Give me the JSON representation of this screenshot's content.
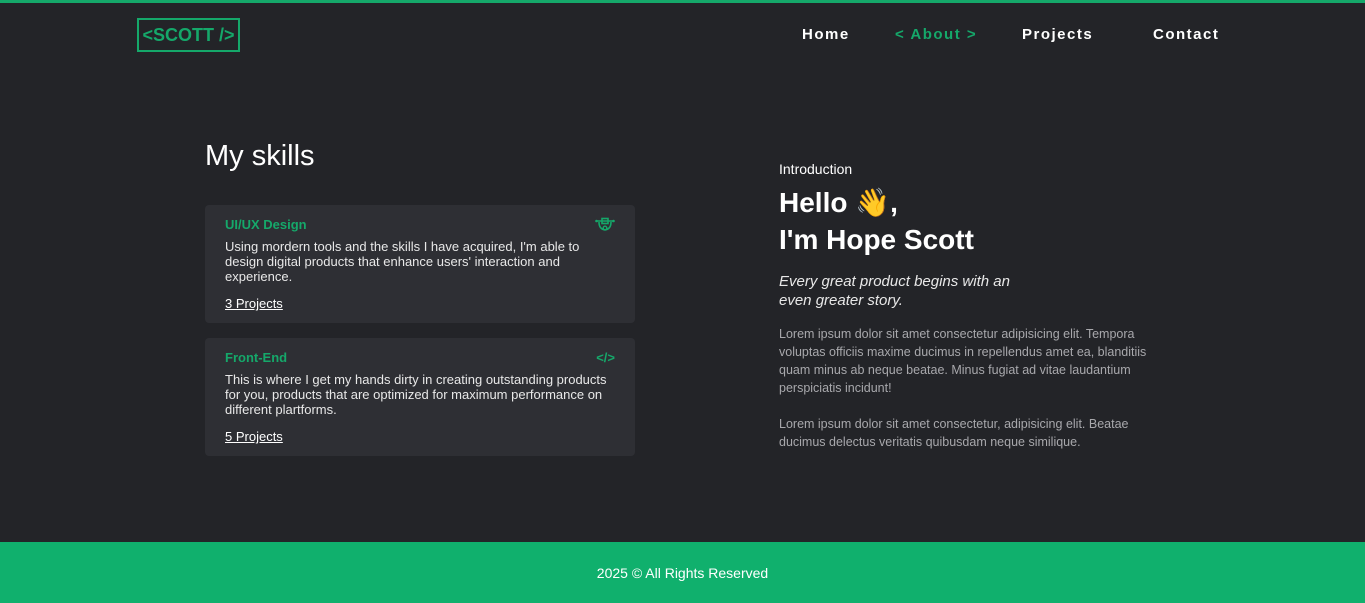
{
  "header": {
    "logo": "<SCOTT />",
    "nav": [
      {
        "label": "Home"
      },
      {
        "label": "< About >"
      },
      {
        "label": "Projects"
      },
      {
        "label": "Contact"
      }
    ]
  },
  "skills": {
    "title": "My skills",
    "items": [
      {
        "title": "UI/UX Design",
        "icon": "design-tool-icon",
        "desc": "Using mordern tools and the skills I have acquired, I'm able to design digital products that enhance users' interaction and experience.",
        "link": "3 Projects"
      },
      {
        "title": "Front-End",
        "icon": "code-icon",
        "icon_glyph": "</>",
        "desc": "This is where I get my hands dirty in creating outstanding products for you, products that are optimized for maximum performance on different plartforms.",
        "link": "5 Projects"
      }
    ]
  },
  "intro": {
    "label": "Introduction",
    "hello": "Hello",
    "wave": "👋",
    "comma": ",",
    "name": "I'm Hope Scott",
    "tagline": "Every great product begins with an even greater story.",
    "para1": "Lorem ipsum dolor sit amet consectetur adipisicing elit. Tempora voluptas officiis maxime ducimus in repellendus amet ea, blanditiis quam minus ab neque beatae. Minus fugiat ad vitae laudantium perspiciatis incidunt!",
    "para2": "Lorem ipsum dolor sit amet consectetur, adipisicing elit. Beatae ducimus delectus veritatis quibusdam neque similique."
  },
  "footer": {
    "text": "2025 © All Rights Reserved"
  },
  "colors": {
    "accent": "#15a86a",
    "background": "#232428",
    "card": "#2e2f34",
    "footer": "#10b06d"
  }
}
